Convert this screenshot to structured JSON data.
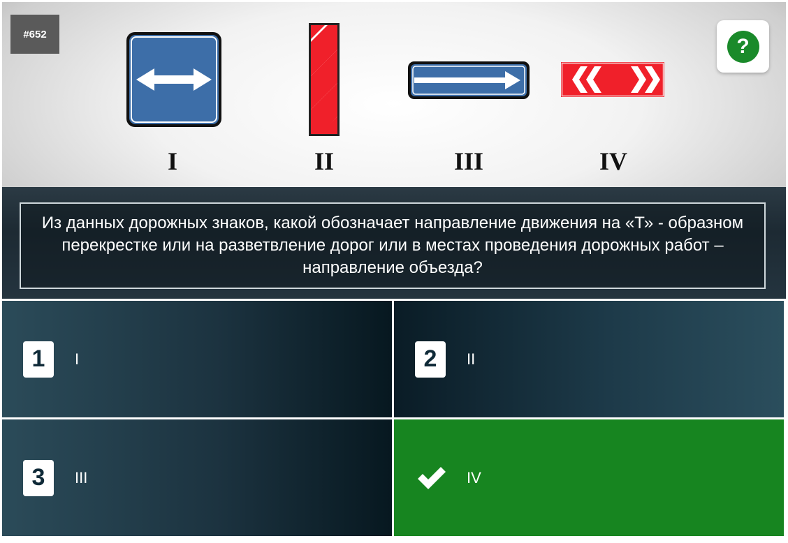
{
  "question": {
    "number": "#652",
    "text": "Из данных дорожных знаков, какой обозначает направление движения на «Т» - образном перекрестке или на разветвление дорог или в местах проведения дорожных работ – направление объезда?"
  },
  "help": {
    "label": "?"
  },
  "signs": [
    {
      "label": "I"
    },
    {
      "label": "II"
    },
    {
      "label": "III"
    },
    {
      "label": "IV"
    }
  ],
  "answers": [
    {
      "number": "1",
      "text": "I"
    },
    {
      "number": "2",
      "text": "II"
    },
    {
      "number": "3",
      "text": "III"
    },
    {
      "number": "",
      "text": "IV",
      "state": "correct"
    }
  ],
  "colors": {
    "sign_blue": "#3d6ea8",
    "sign_red": "#f0202a",
    "correct_green": "#178520"
  }
}
